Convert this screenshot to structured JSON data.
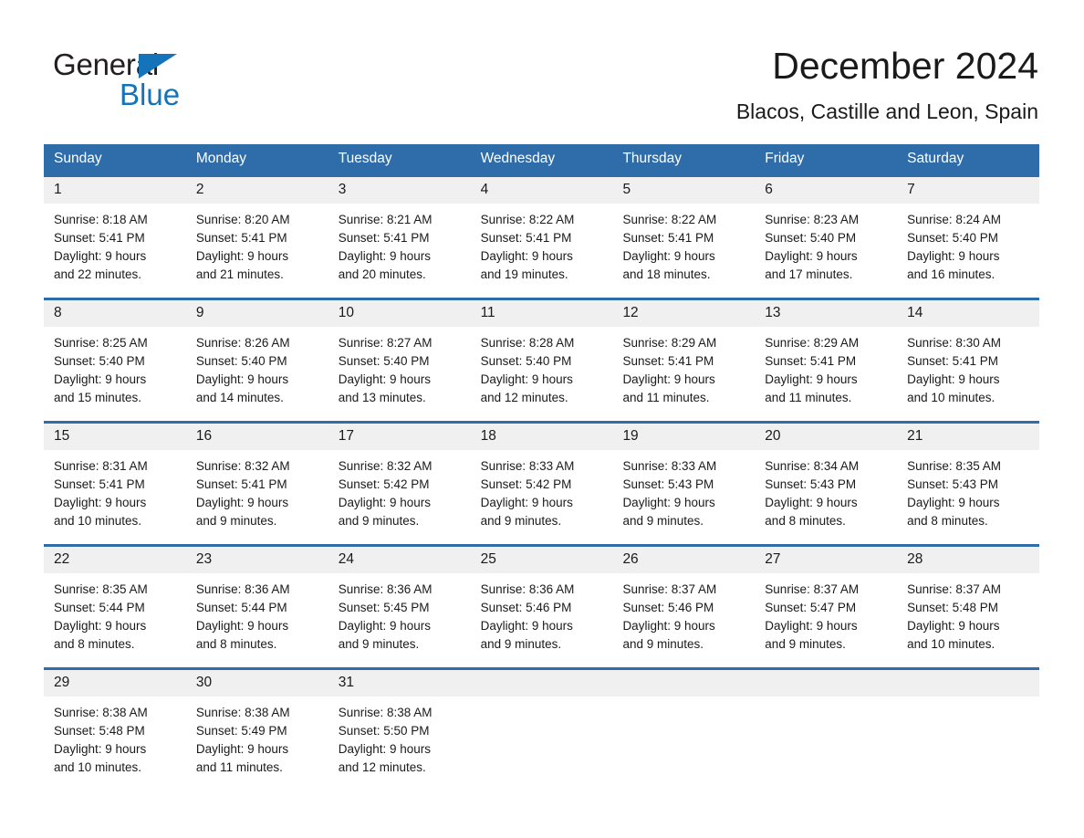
{
  "brand": {
    "name_part1": "General",
    "name_part2": "Blue",
    "accent_color": "#1573b9"
  },
  "header": {
    "title": "December 2024",
    "subtitle": "Blacos, Castille and Leon, Spain"
  },
  "theme": {
    "header_blue": "#2e6da9",
    "daynum_band": "#f0f0f0",
    "text": "#1a1a1a"
  },
  "weekday_headers": [
    "Sunday",
    "Monday",
    "Tuesday",
    "Wednesday",
    "Thursday",
    "Friday",
    "Saturday"
  ],
  "weeks": [
    [
      {
        "day": "1",
        "sunrise": "Sunrise: 8:18 AM",
        "sunset": "Sunset: 5:41 PM",
        "daylight_line1": "Daylight: 9 hours",
        "daylight_line2": "and 22 minutes."
      },
      {
        "day": "2",
        "sunrise": "Sunrise: 8:20 AM",
        "sunset": "Sunset: 5:41 PM",
        "daylight_line1": "Daylight: 9 hours",
        "daylight_line2": "and 21 minutes."
      },
      {
        "day": "3",
        "sunrise": "Sunrise: 8:21 AM",
        "sunset": "Sunset: 5:41 PM",
        "daylight_line1": "Daylight: 9 hours",
        "daylight_line2": "and 20 minutes."
      },
      {
        "day": "4",
        "sunrise": "Sunrise: 8:22 AM",
        "sunset": "Sunset: 5:41 PM",
        "daylight_line1": "Daylight: 9 hours",
        "daylight_line2": "and 19 minutes."
      },
      {
        "day": "5",
        "sunrise": "Sunrise: 8:22 AM",
        "sunset": "Sunset: 5:41 PM",
        "daylight_line1": "Daylight: 9 hours",
        "daylight_line2": "and 18 minutes."
      },
      {
        "day": "6",
        "sunrise": "Sunrise: 8:23 AM",
        "sunset": "Sunset: 5:40 PM",
        "daylight_line1": "Daylight: 9 hours",
        "daylight_line2": "and 17 minutes."
      },
      {
        "day": "7",
        "sunrise": "Sunrise: 8:24 AM",
        "sunset": "Sunset: 5:40 PM",
        "daylight_line1": "Daylight: 9 hours",
        "daylight_line2": "and 16 minutes."
      }
    ],
    [
      {
        "day": "8",
        "sunrise": "Sunrise: 8:25 AM",
        "sunset": "Sunset: 5:40 PM",
        "daylight_line1": "Daylight: 9 hours",
        "daylight_line2": "and 15 minutes."
      },
      {
        "day": "9",
        "sunrise": "Sunrise: 8:26 AM",
        "sunset": "Sunset: 5:40 PM",
        "daylight_line1": "Daylight: 9 hours",
        "daylight_line2": "and 14 minutes."
      },
      {
        "day": "10",
        "sunrise": "Sunrise: 8:27 AM",
        "sunset": "Sunset: 5:40 PM",
        "daylight_line1": "Daylight: 9 hours",
        "daylight_line2": "and 13 minutes."
      },
      {
        "day": "11",
        "sunrise": "Sunrise: 8:28 AM",
        "sunset": "Sunset: 5:40 PM",
        "daylight_line1": "Daylight: 9 hours",
        "daylight_line2": "and 12 minutes."
      },
      {
        "day": "12",
        "sunrise": "Sunrise: 8:29 AM",
        "sunset": "Sunset: 5:41 PM",
        "daylight_line1": "Daylight: 9 hours",
        "daylight_line2": "and 11 minutes."
      },
      {
        "day": "13",
        "sunrise": "Sunrise: 8:29 AM",
        "sunset": "Sunset: 5:41 PM",
        "daylight_line1": "Daylight: 9 hours",
        "daylight_line2": "and 11 minutes."
      },
      {
        "day": "14",
        "sunrise": "Sunrise: 8:30 AM",
        "sunset": "Sunset: 5:41 PM",
        "daylight_line1": "Daylight: 9 hours",
        "daylight_line2": "and 10 minutes."
      }
    ],
    [
      {
        "day": "15",
        "sunrise": "Sunrise: 8:31 AM",
        "sunset": "Sunset: 5:41 PM",
        "daylight_line1": "Daylight: 9 hours",
        "daylight_line2": "and 10 minutes."
      },
      {
        "day": "16",
        "sunrise": "Sunrise: 8:32 AM",
        "sunset": "Sunset: 5:41 PM",
        "daylight_line1": "Daylight: 9 hours",
        "daylight_line2": "and 9 minutes."
      },
      {
        "day": "17",
        "sunrise": "Sunrise: 8:32 AM",
        "sunset": "Sunset: 5:42 PM",
        "daylight_line1": "Daylight: 9 hours",
        "daylight_line2": "and 9 minutes."
      },
      {
        "day": "18",
        "sunrise": "Sunrise: 8:33 AM",
        "sunset": "Sunset: 5:42 PM",
        "daylight_line1": "Daylight: 9 hours",
        "daylight_line2": "and 9 minutes."
      },
      {
        "day": "19",
        "sunrise": "Sunrise: 8:33 AM",
        "sunset": "Sunset: 5:43 PM",
        "daylight_line1": "Daylight: 9 hours",
        "daylight_line2": "and 9 minutes."
      },
      {
        "day": "20",
        "sunrise": "Sunrise: 8:34 AM",
        "sunset": "Sunset: 5:43 PM",
        "daylight_line1": "Daylight: 9 hours",
        "daylight_line2": "and 8 minutes."
      },
      {
        "day": "21",
        "sunrise": "Sunrise: 8:35 AM",
        "sunset": "Sunset: 5:43 PM",
        "daylight_line1": "Daylight: 9 hours",
        "daylight_line2": "and 8 minutes."
      }
    ],
    [
      {
        "day": "22",
        "sunrise": "Sunrise: 8:35 AM",
        "sunset": "Sunset: 5:44 PM",
        "daylight_line1": "Daylight: 9 hours",
        "daylight_line2": "and 8 minutes."
      },
      {
        "day": "23",
        "sunrise": "Sunrise: 8:36 AM",
        "sunset": "Sunset: 5:44 PM",
        "daylight_line1": "Daylight: 9 hours",
        "daylight_line2": "and 8 minutes."
      },
      {
        "day": "24",
        "sunrise": "Sunrise: 8:36 AM",
        "sunset": "Sunset: 5:45 PM",
        "daylight_line1": "Daylight: 9 hours",
        "daylight_line2": "and 9 minutes."
      },
      {
        "day": "25",
        "sunrise": "Sunrise: 8:36 AM",
        "sunset": "Sunset: 5:46 PM",
        "daylight_line1": "Daylight: 9 hours",
        "daylight_line2": "and 9 minutes."
      },
      {
        "day": "26",
        "sunrise": "Sunrise: 8:37 AM",
        "sunset": "Sunset: 5:46 PM",
        "daylight_line1": "Daylight: 9 hours",
        "daylight_line2": "and 9 minutes."
      },
      {
        "day": "27",
        "sunrise": "Sunrise: 8:37 AM",
        "sunset": "Sunset: 5:47 PM",
        "daylight_line1": "Daylight: 9 hours",
        "daylight_line2": "and 9 minutes."
      },
      {
        "day": "28",
        "sunrise": "Sunrise: 8:37 AM",
        "sunset": "Sunset: 5:48 PM",
        "daylight_line1": "Daylight: 9 hours",
        "daylight_line2": "and 10 minutes."
      }
    ],
    [
      {
        "day": "29",
        "sunrise": "Sunrise: 8:38 AM",
        "sunset": "Sunset: 5:48 PM",
        "daylight_line1": "Daylight: 9 hours",
        "daylight_line2": "and 10 minutes."
      },
      {
        "day": "30",
        "sunrise": "Sunrise: 8:38 AM",
        "sunset": "Sunset: 5:49 PM",
        "daylight_line1": "Daylight: 9 hours",
        "daylight_line2": "and 11 minutes."
      },
      {
        "day": "31",
        "sunrise": "Sunrise: 8:38 AM",
        "sunset": "Sunset: 5:50 PM",
        "daylight_line1": "Daylight: 9 hours",
        "daylight_line2": "and 12 minutes."
      },
      {
        "day": "",
        "sunrise": "",
        "sunset": "",
        "daylight_line1": "",
        "daylight_line2": ""
      },
      {
        "day": "",
        "sunrise": "",
        "sunset": "",
        "daylight_line1": "",
        "daylight_line2": ""
      },
      {
        "day": "",
        "sunrise": "",
        "sunset": "",
        "daylight_line1": "",
        "daylight_line2": ""
      },
      {
        "day": "",
        "sunrise": "",
        "sunset": "",
        "daylight_line1": "",
        "daylight_line2": ""
      }
    ]
  ]
}
